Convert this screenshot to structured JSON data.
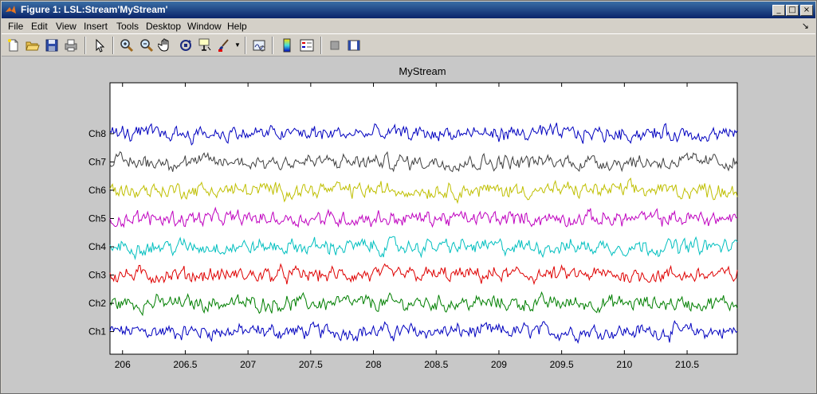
{
  "window": {
    "title": "Figure 1: LSL:Stream'MyStream'",
    "controls": [
      "minimize",
      "maximize",
      "close"
    ]
  },
  "menu": {
    "items": [
      "File",
      "Edit",
      "View",
      "Insert",
      "Tools",
      "Desktop",
      "Window",
      "Help"
    ],
    "dock_glyph": "↘"
  },
  "toolbar": {
    "icons": [
      "new-figure-icon",
      "open-file-icon",
      "save-figure-icon",
      "print-figure-icon",
      "edit-plot-arrow-icon",
      "zoom-in-icon",
      "zoom-out-icon",
      "pan-hand-icon",
      "rotate-3d-icon",
      "data-cursor-icon",
      "brush-icon",
      "link-plot-icon",
      "colorbar-icon",
      "legend-icon",
      "hide-plot-tools-icon",
      "show-plot-tools-icon"
    ]
  },
  "chart_data": {
    "type": "line",
    "title": "MyStream",
    "xlabel": "",
    "ylabel": "",
    "xlim": [
      205.9,
      210.9
    ],
    "xticks": [
      206,
      206.5,
      207,
      207.5,
      208,
      208.5,
      209,
      209.5,
      210,
      210.5
    ],
    "xtick_labels": [
      "206",
      "206.5",
      "207",
      "207.5",
      "208",
      "208.5",
      "209",
      "209.5",
      "210",
      "210.5"
    ],
    "grid": false,
    "legend": "none",
    "series": [
      {
        "name": "Ch1",
        "color": "#0000bf",
        "offset": 1
      },
      {
        "name": "Ch2",
        "color": "#007f00",
        "offset": 2
      },
      {
        "name": "Ch3",
        "color": "#df0000",
        "offset": 3
      },
      {
        "name": "Ch4",
        "color": "#00bfbf",
        "offset": 4
      },
      {
        "name": "Ch5",
        "color": "#bf00bf",
        "offset": 5
      },
      {
        "name": "Ch6",
        "color": "#bfbf00",
        "offset": 6
      },
      {
        "name": "Ch7",
        "color": "#3f3f3f",
        "offset": 7
      },
      {
        "name": "Ch8",
        "color": "#0000bf",
        "offset": 8
      }
    ],
    "ylim": [
      0.2,
      9.8
    ]
  }
}
